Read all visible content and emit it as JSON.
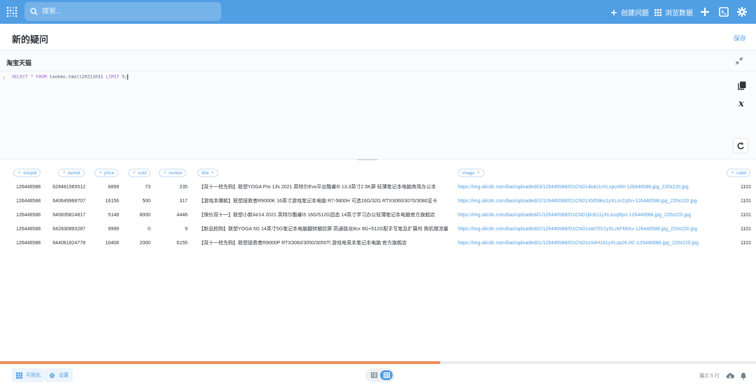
{
  "navbar": {
    "search_placeholder": "搜索...",
    "new_question_label": "创建问题",
    "browse_data_label": "浏览数据"
  },
  "header": {
    "title": "新的疑问",
    "save_label": "保存"
  },
  "editor": {
    "database_name": "淘宝天猫",
    "line_number": "1",
    "sql": {
      "kw_select": "SELECT",
      "star": " * ",
      "kw_from": "FROM",
      "table": " taobao.tmall20211031 ",
      "kw_limit": "LIMIT",
      "limit_value": " 5;"
    }
  },
  "table": {
    "columns": [
      "shopid",
      "itemid",
      "price",
      "sold",
      "review",
      "title",
      "image",
      "catid"
    ],
    "rows": [
      [
        "126446588",
        "628481565512",
        "6899",
        "73",
        "235",
        "【双十一抢先购】联想YOGA Pro 13s 2021 英特尔Evo平台酷睿i5 13.3英寸2.5K屏 轻薄笔记本电脑商用办公本",
        "https://img.alicdn.com/bao/uploaded/i3/126446588/O1CN01dioki1vXLzpcrMII-126446588.jpg_220x220.jpg",
        "1101"
      ],
      [
        "126446588",
        "640649968707",
        "16156",
        "500",
        "317",
        "【游戏本爆款】联想拯救者R9000K 16英寸游戏笔记本电脑 R7-5800H 可选16G/32G RTX3060/3070/3080显卡",
        "https://img.alicdn.com/bao/uploaded/i2/126446588/O1CN01XM59ko1yXLzv2zj5n-126446588.jpg_220x220.jpg",
        "1101"
      ],
      [
        "126446588",
        "640835814817",
        "5148",
        "8000",
        "4446",
        "【保价双十一】联想小新Air14 2021 英特尔酷睿i5 16G/512G固态 14英寸学习办公轻薄笔记本电脑官方旗舰店",
        "https://img.alicdn.com/bao/uploaded/i1/126446588/O1CN01jln9i11yXLzozjBpo-126446588.jpg_220x220.jpg",
        "1101"
      ],
      [
        "126446588",
        "642830893287",
        "9999",
        "0",
        "9",
        "【新品抢购】联想YOGA 5G 14英寸5G笔记本电脑翻转触控屏 高通骁龙8cx 8G+512G配手写笔及扩展坞 购机赠流量",
        "https://img.alicdn.com/bao/uploaded/i2/126446588/O1CN01sa07GI1yXLzkFMiXu-126446588.jpg_220x220.jpg",
        "1101"
      ],
      [
        "126446588",
        "644081824778",
        "10408",
        "2000",
        "6155",
        "【双十一抢先购】联想拯救者R9000P RTX3060/3050/3050Ti 游戏电竞本笔记本电脑 官方旗舰店",
        "https://img.alicdn.com/bao/uploaded/i1/126446588/O1CN01nX4H141yXLzp2KJIC-126446588.jpg_220x220.jpg",
        "1101"
      ]
    ]
  },
  "progress": {
    "fraction": 0.582
  },
  "footer": {
    "visualize_label": "可视化",
    "settings_label": "设置",
    "row_count": "展示 5 行"
  },
  "colors": {
    "brand": "#509ee3",
    "progress": "#ef8c5a",
    "text": "#2e353b"
  },
  "icons": [
    "logo-icon",
    "search-icon",
    "plus-icon",
    "grid-icon",
    "add-icon",
    "sql-editor-icon",
    "gear-icon",
    "expand-icon",
    "snippet-icon",
    "variable-icon",
    "run-icon",
    "table-icon",
    "download-icon",
    "bell-icon"
  ]
}
